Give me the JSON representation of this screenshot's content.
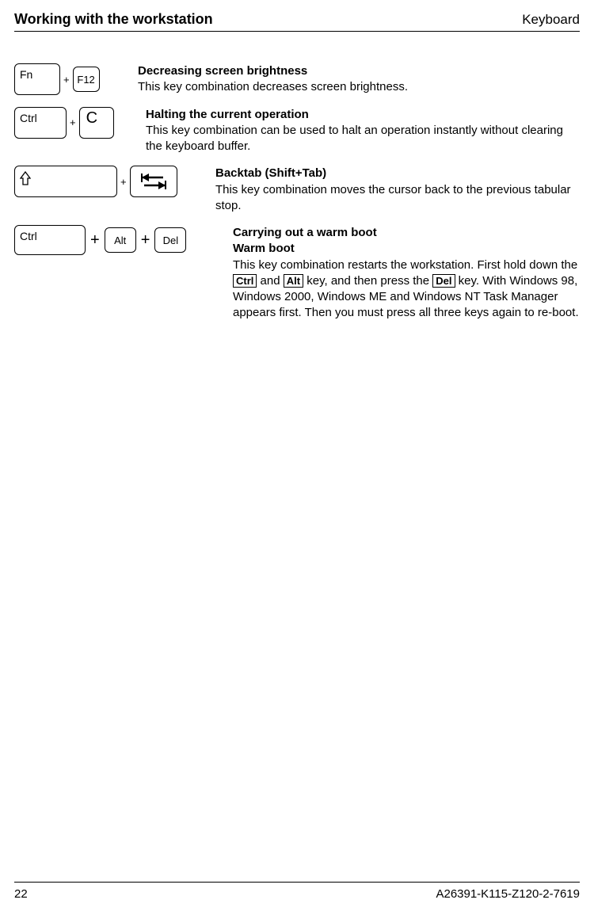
{
  "header": {
    "left": "Working with the workstation",
    "right": "Keyboard"
  },
  "rows": [
    {
      "keys": [
        "Fn",
        "F12"
      ],
      "title": "Decreasing screen brightness",
      "body": "This key combination decreases screen brightness."
    },
    {
      "keys": [
        "Ctrl",
        "C"
      ],
      "title": "Halting the current operation",
      "body": "This key combination can be used to halt an operation instantly without clearing the keyboard buffer."
    },
    {
      "keys": [
        "Shift",
        "BacktabIcon"
      ],
      "title": "Backtab (Shift+Tab)",
      "body": "This key combination moves the cursor back to the previous tabular stop."
    },
    {
      "keys": [
        "Ctrl",
        "Alt",
        "Del"
      ],
      "title": "Carrying out a warm boot",
      "subtitle": "Warm boot",
      "body_pre": "This key combination restarts the workstation. First hold down the ",
      "inline1": "Ctrl",
      "body_mid1": " and ",
      "inline2": "Alt",
      "body_mid2": " key, and then press the ",
      "inline3": "Del",
      "body_post": " key. With Windows 98, Windows 2000, Windows ME and Windows NT Task Manager appears first. Then you must press all three keys again to re-boot."
    }
  ],
  "footer": {
    "page": "22",
    "docnum": "A26391-K115-Z120-2-7619"
  }
}
